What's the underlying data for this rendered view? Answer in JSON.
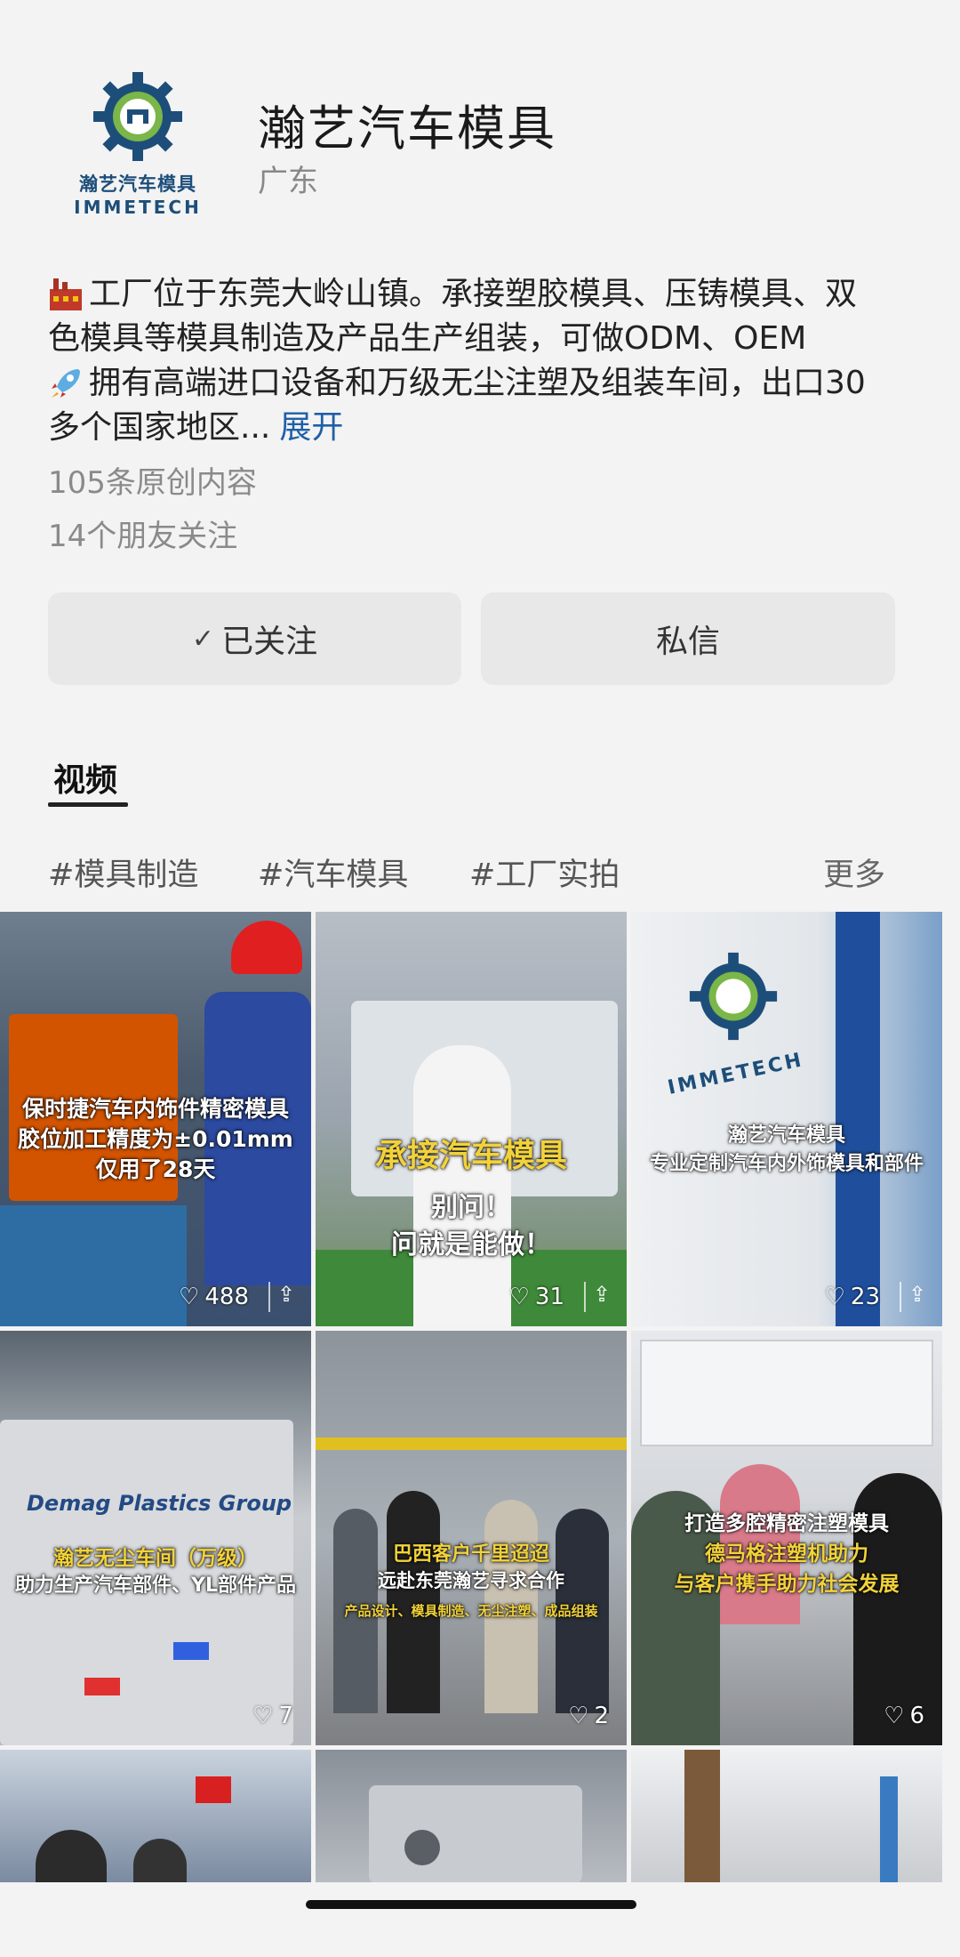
{
  "profile": {
    "logo_cn": "瀚艺汽车模具",
    "logo_en": "IMMETECH",
    "name": "瀚艺汽车模具",
    "region": "广东",
    "bio_lines": [
      "工厂位于东莞大岭山镇。承接塑胶模具、压铸模具、双",
      "色模具等模具制造及产品生产组装，可做ODM、OEM",
      "拥有高端进口设备和万级无尘注塑及组装车间，出口30",
      "多个国家地区..."
    ],
    "bio_expand": "展开",
    "original_count": "105条原创内容",
    "friends_follow": "14个朋友关注",
    "accent_color": "#1f5fa8"
  },
  "actions": {
    "follow_label": "已关注",
    "message_label": "私信"
  },
  "tabs": {
    "video_label": "视频"
  },
  "tags": [
    "#模具制造",
    "#汽车模具",
    "#工厂实拍"
  ],
  "tags_more": "更多",
  "videos": [
    {
      "overlay": [
        "保时捷汽车内饰件精密模具",
        "胶位加工精度为±0.01mm",
        "仅用了28天"
      ],
      "likes": "488"
    },
    {
      "overlay_yellow": "承接汽车模具",
      "overlay": [
        "别问！",
        "问就是能做！"
      ],
      "likes": "31"
    },
    {
      "overlay": [
        "瀚艺汽车模具",
        "专业定制汽车内外饰模具和部件"
      ],
      "likes": "23"
    },
    {
      "overlay_yellow": "瀚艺无尘车间（万级）",
      "overlay": [
        "助力生产汽车部件、YL部件产品"
      ],
      "likes": "7"
    },
    {
      "overlay_yellow": "巴西客户千里迢迢",
      "overlay": [
        "远赴东莞瀚艺寻求合作",
        "产品设计、模具制造、无尘注塑、成品组装"
      ],
      "likes": "2"
    },
    {
      "overlay": [
        "打造多腔精密注塑模具",
        "德马格注塑机助力",
        "与客户携手助力社会发展"
      ],
      "likes": "6"
    }
  ],
  "video_sign_text": "Demag Plastics Group",
  "video_logo_text": "IMMETECH"
}
